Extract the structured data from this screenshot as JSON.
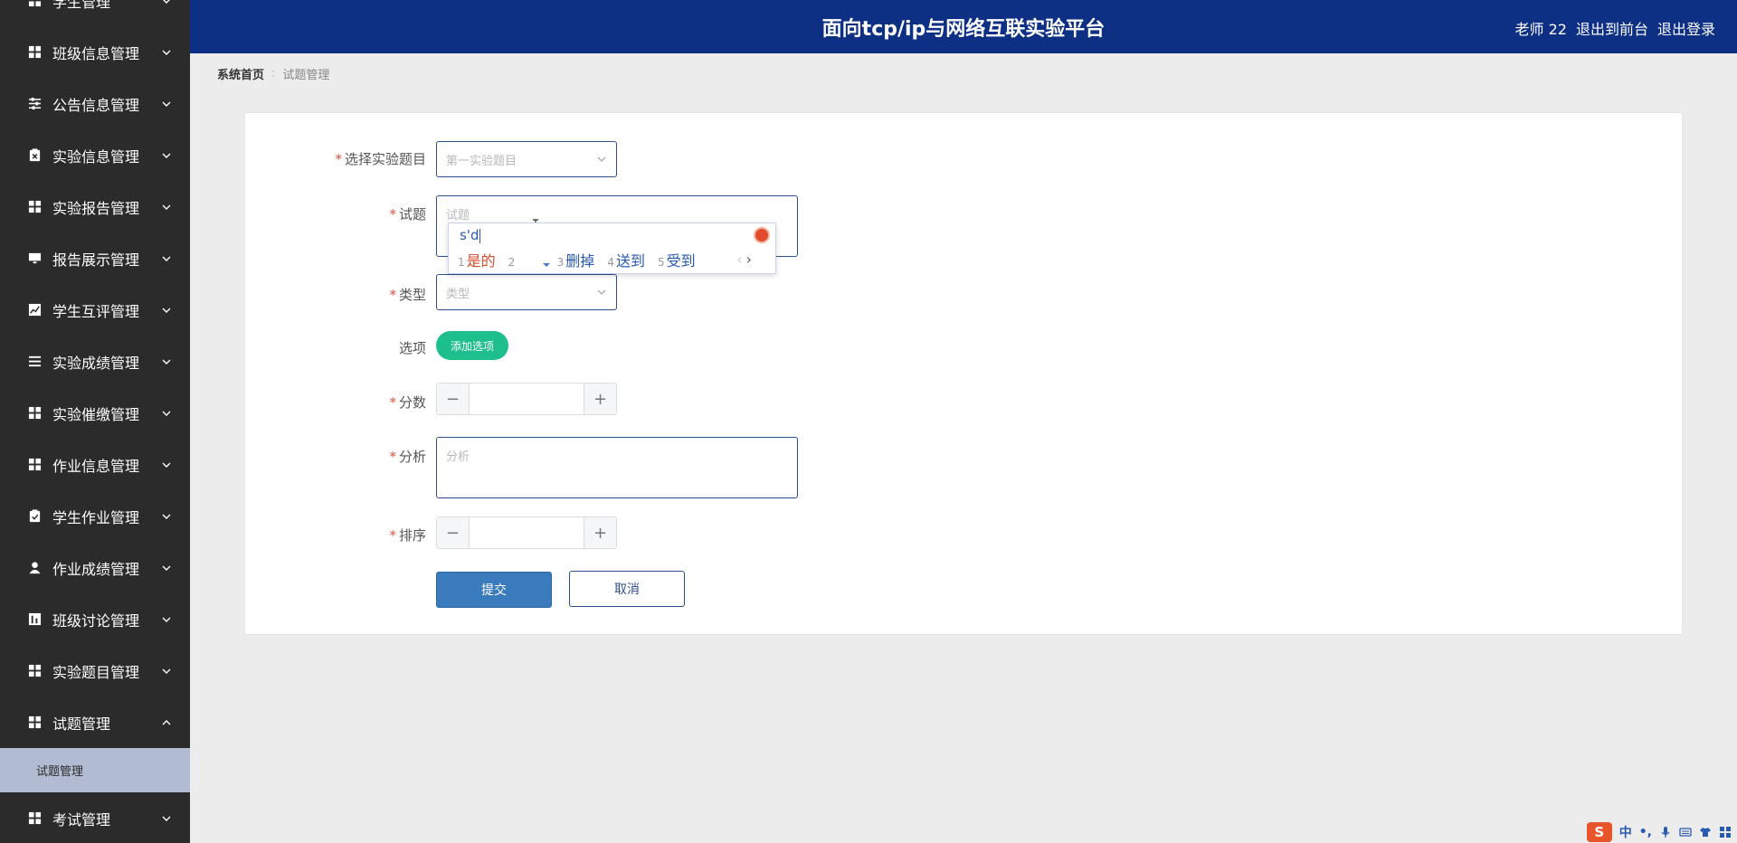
{
  "header": {
    "title": "面向tcp/ip与网络互联实验平台",
    "user": "老师 22",
    "front_link": "退出到前台",
    "logout_link": "退出登录"
  },
  "sidebar": {
    "items": [
      {
        "label": "学生管理",
        "icon": "grid-icon",
        "expanded": false
      },
      {
        "label": "班级信息管理",
        "icon": "grid-icon",
        "expanded": false
      },
      {
        "label": "公告信息管理",
        "icon": "sliders-icon",
        "expanded": false
      },
      {
        "label": "实验信息管理",
        "icon": "clipboard-x-icon",
        "expanded": false
      },
      {
        "label": "实验报告管理",
        "icon": "grid-icon",
        "expanded": false
      },
      {
        "label": "报告展示管理",
        "icon": "monitor-icon",
        "expanded": false
      },
      {
        "label": "学生互评管理",
        "icon": "chart-line-icon",
        "expanded": false
      },
      {
        "label": "实验成绩管理",
        "icon": "list-icon",
        "expanded": false
      },
      {
        "label": "实验催缴管理",
        "icon": "grid-icon",
        "expanded": false
      },
      {
        "label": "作业信息管理",
        "icon": "grid-icon",
        "expanded": false
      },
      {
        "label": "学生作业管理",
        "icon": "clipboard-check-icon",
        "expanded": false
      },
      {
        "label": "作业成绩管理",
        "icon": "user-icon",
        "expanded": false
      },
      {
        "label": "班级讨论管理",
        "icon": "bar-chart-icon",
        "expanded": false
      },
      {
        "label": "实验题目管理",
        "icon": "grid-icon",
        "expanded": false
      },
      {
        "label": "试题管理",
        "icon": "grid-icon",
        "expanded": true
      },
      {
        "label": "考试管理",
        "icon": "grid-icon",
        "expanded": false
      }
    ],
    "active_sub": "试题管理"
  },
  "breadcrumb": {
    "home": "系统首页",
    "separator": ":",
    "current": "试题管理"
  },
  "form": {
    "experiment": {
      "label": "选择实验题目",
      "placeholder": "第一实验题目"
    },
    "question": {
      "label": "试题",
      "placeholder": "试题"
    },
    "type": {
      "label": "类型",
      "placeholder": "类型"
    },
    "options": {
      "label": "选项",
      "add_button": "添加选项"
    },
    "score": {
      "label": "分数",
      "minus": "−",
      "plus": "+"
    },
    "analysis": {
      "label": "分析",
      "placeholder": "分析"
    },
    "order": {
      "label": "排序",
      "minus": "−",
      "plus": "+"
    },
    "submit": "提交",
    "cancel": "取消",
    "required_mark": "*"
  },
  "ime": {
    "input": "s'd",
    "candidates": [
      {
        "num": "1",
        "text": "是的"
      },
      {
        "num": "2",
        "text": ""
      },
      {
        "num": "3",
        "text": "删掉"
      },
      {
        "num": "4",
        "text": "送到"
      },
      {
        "num": "5",
        "text": "受到"
      }
    ],
    "prev": "‹",
    "next": "›"
  },
  "tray": {
    "logo": "S",
    "lang": "中",
    "punct": "•,"
  },
  "colors": {
    "header_bg": "#0d2f84",
    "sidebar_bg": "#2b2b2b",
    "active_sub_bg": "#b1bbd1",
    "add_button": "#1dbf8c",
    "submit_button": "#3a7bbd",
    "required": "#e74c3c"
  }
}
